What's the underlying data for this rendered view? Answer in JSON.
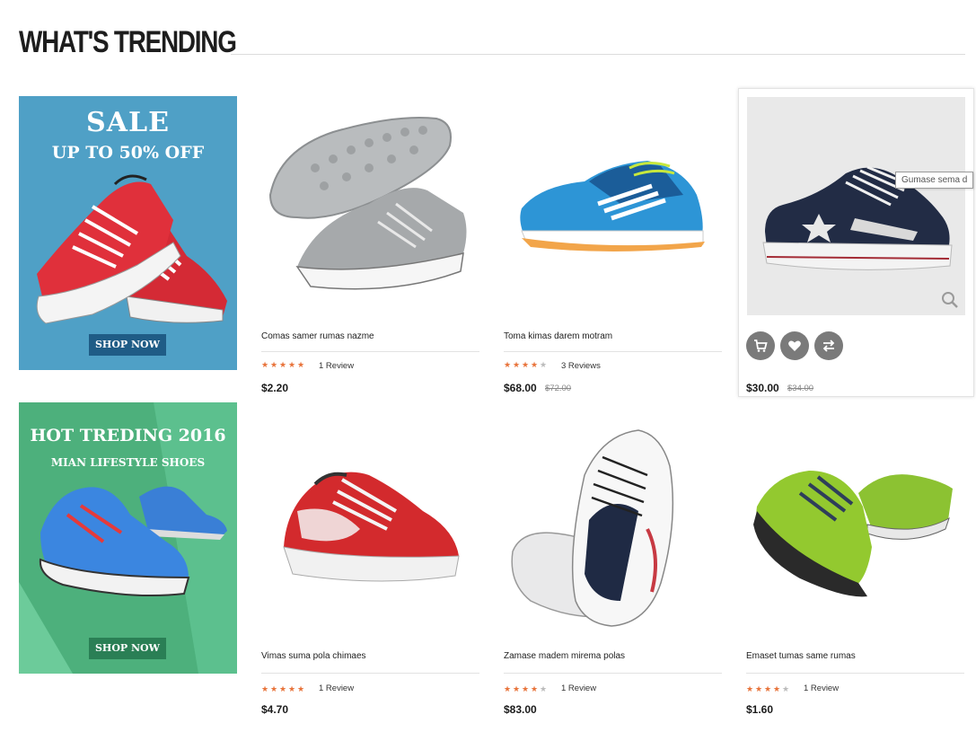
{
  "section": {
    "title": "WHAT'S TRENDING"
  },
  "banners": [
    {
      "line1": "SALE",
      "line2": "UP TO 50% OFF",
      "button": "SHOP NOW",
      "bg": "#4fa0c6"
    },
    {
      "line1": "HOT TREDING 2016",
      "line2": "MIAN LIFESTYLE SHOES",
      "button": "SHOP NOW",
      "bg": "#4db07c"
    }
  ],
  "products": [
    {
      "name": "Comas samer rumas nazme",
      "rating": 5,
      "reviews": "1 Review",
      "price": "$2.20",
      "old_price": ""
    },
    {
      "name": "Toma kimas darem motram",
      "rating": 4,
      "reviews": "3 Reviews",
      "price": "$68.00",
      "old_price": "$72.00"
    },
    {
      "name": "",
      "rating": 0,
      "reviews": "",
      "price": "$30.00",
      "old_price": "$34.00",
      "actions": [
        "cart-icon",
        "heart-icon",
        "compare-icon"
      ]
    },
    {
      "name": "Vimas suma pola chimaes",
      "rating": 5,
      "reviews": "1 Review",
      "price": "$4.70",
      "old_price": ""
    },
    {
      "name": "Zamase madem mirema polas",
      "rating": 4,
      "reviews": "1 Review",
      "price": "$83.00",
      "old_price": ""
    },
    {
      "name": "Emaset tumas same rumas",
      "rating": 4,
      "reviews": "1 Review",
      "price": "$1.60",
      "old_price": ""
    }
  ],
  "tooltip": "Gumase sema d",
  "colors": {
    "star": "#e8733a",
    "star_empty": "#bbbbbb",
    "action": "#7a7a7a"
  }
}
